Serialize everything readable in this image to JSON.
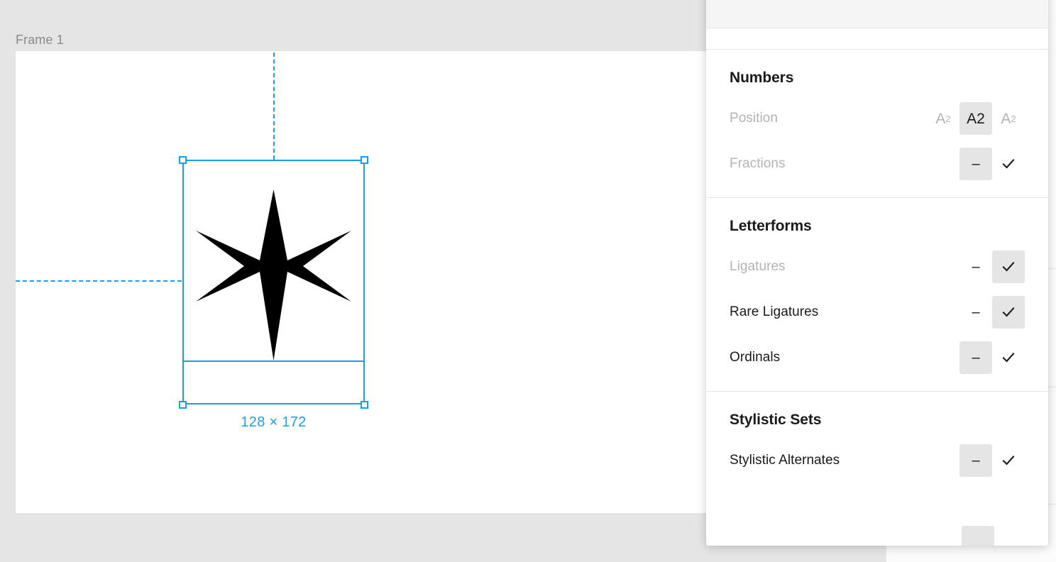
{
  "canvas": {
    "frame_label": "Frame 1",
    "selection": {
      "dimension_label": "128 × 172",
      "width": 128,
      "height": 172,
      "accent_color": "#1b9cf0"
    },
    "shape": {
      "name": "six-pointed-star",
      "fill_color": "#000000",
      "points": 6
    },
    "background_color": "#e5e5e5",
    "frame_color": "#ffffff"
  },
  "popover": {
    "sections": [
      {
        "title": "Numbers",
        "rows": [
          {
            "label": "Position",
            "muted": true,
            "controls": [
              {
                "type": "glyph",
                "text": "A",
                "sub": "2",
                "selected": false,
                "dim": true,
                "name": "position-subscript-option"
              },
              {
                "type": "glyph",
                "text": "A2",
                "selected": true,
                "dim": false,
                "name": "position-normal-option"
              },
              {
                "type": "glyph",
                "text": "A",
                "sup": "2",
                "selected": false,
                "dim": true,
                "name": "position-superscript-option"
              }
            ]
          },
          {
            "label": "Fractions",
            "muted": true,
            "controls": [
              {
                "type": "dash",
                "text": "–",
                "selected": true,
                "name": "fractions-off-option"
              },
              {
                "type": "check",
                "selected": false,
                "name": "fractions-on-option"
              }
            ]
          }
        ]
      },
      {
        "title": "Letterforms",
        "rows": [
          {
            "label": "Ligatures",
            "muted": true,
            "controls": [
              {
                "type": "dash",
                "text": "–",
                "selected": false,
                "name": "ligatures-off-option"
              },
              {
                "type": "check",
                "selected": true,
                "name": "ligatures-on-option"
              }
            ]
          },
          {
            "label": "Rare Ligatures",
            "muted": false,
            "controls": [
              {
                "type": "dash",
                "text": "–",
                "selected": false,
                "name": "rare-ligatures-off-option"
              },
              {
                "type": "check",
                "selected": true,
                "name": "rare-ligatures-on-option"
              }
            ]
          },
          {
            "label": "Ordinals",
            "muted": false,
            "controls": [
              {
                "type": "dash",
                "text": "–",
                "selected": true,
                "name": "ordinals-off-option"
              },
              {
                "type": "check",
                "selected": false,
                "name": "ordinals-on-option"
              }
            ]
          }
        ]
      },
      {
        "title": "Stylistic Sets",
        "rows": [
          {
            "label": "Stylistic Alternates",
            "muted": false,
            "controls": [
              {
                "type": "dash",
                "text": "–",
                "selected": true,
                "name": "stylistic-alternates-off-option"
              },
              {
                "type": "check",
                "selected": false,
                "name": "stylistic-alternates-on-option"
              }
            ]
          }
        ]
      }
    ],
    "colors": {
      "selected_swatch": "#e5e5e5",
      "header_background": "#f5f5f5",
      "divider": "#e5e5e5",
      "text": "#1a1a1a",
      "muted_text": "#b3b3b3"
    }
  }
}
